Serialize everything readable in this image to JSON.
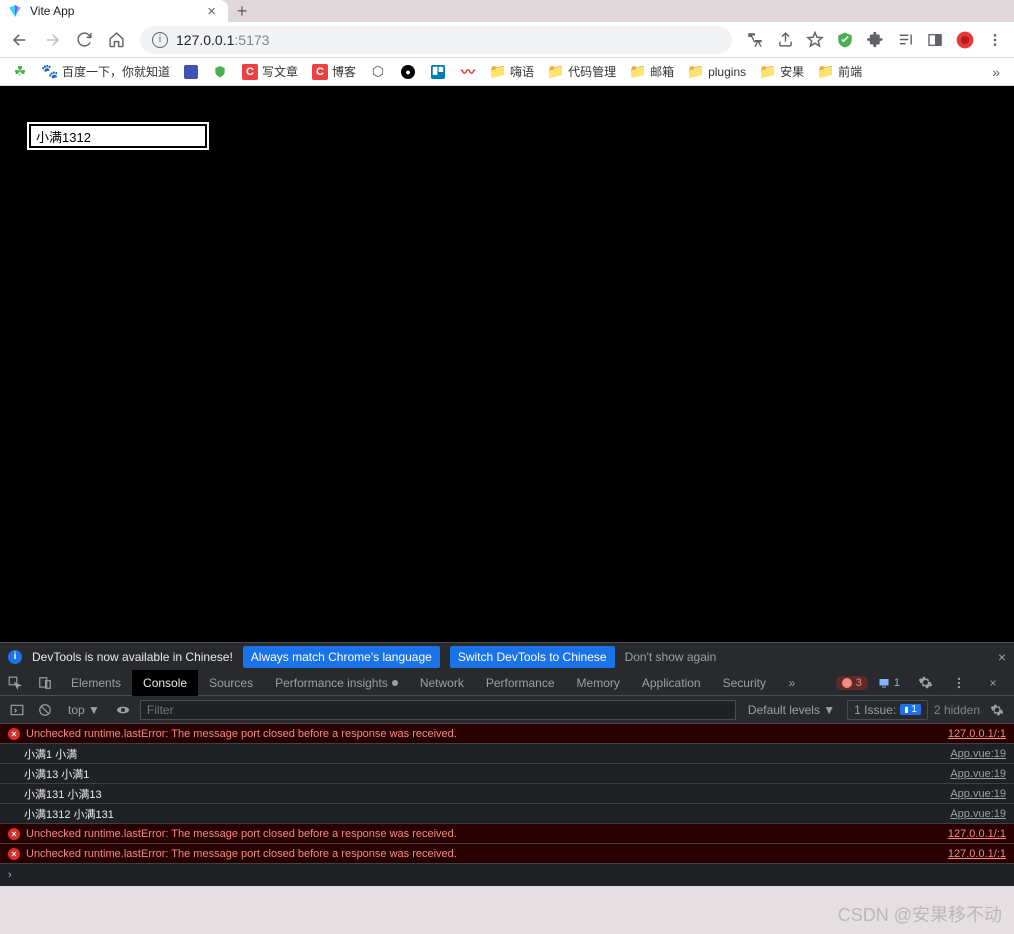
{
  "tab": {
    "title": "Vite App"
  },
  "address": {
    "host": "127.0.0.1",
    "port": ":5173"
  },
  "bookmarks": [
    {
      "label": "",
      "icon": "clover",
      "color": "#4caf50"
    },
    {
      "label": "百度一下，你就知道",
      "icon": "paw",
      "color": "#2932e1"
    },
    {
      "label": "",
      "icon": "shape",
      "color": "#3f51b5"
    },
    {
      "label": "",
      "icon": "shield",
      "color": "#4caf50"
    },
    {
      "label": "写文章",
      "icon": "C",
      "color": "#ec4141"
    },
    {
      "label": "博客",
      "icon": "C",
      "color": "#ec4141"
    },
    {
      "label": "",
      "icon": "hex",
      "color": "#555"
    },
    {
      "label": "",
      "icon": "dot",
      "color": "#000"
    },
    {
      "label": "",
      "icon": "trello",
      "color": "#0079bf"
    },
    {
      "label": "",
      "icon": "wave",
      "color": "#e53935"
    },
    {
      "label": "嗨语",
      "icon": "folder"
    },
    {
      "label": "代码管理",
      "icon": "folder"
    },
    {
      "label": "邮箱",
      "icon": "folder"
    },
    {
      "label": "plugins",
      "icon": "folder"
    },
    {
      "label": "安果",
      "icon": "folder"
    },
    {
      "label": "前端",
      "icon": "folder"
    }
  ],
  "page": {
    "input_value": "小满1312"
  },
  "banner": {
    "text": "DevTools is now available in Chinese!",
    "btn1": "Always match Chrome's language",
    "btn2": "Switch DevTools to Chinese",
    "dismiss": "Don't show again"
  },
  "devtools_tabs": [
    "Elements",
    "Console",
    "Sources",
    "Performance insights",
    "Network",
    "Performance",
    "Memory",
    "Application",
    "Security"
  ],
  "devtools_active": "Console",
  "error_count": "3",
  "issue_count": "1",
  "console": {
    "context": "top",
    "filter_placeholder": "Filter",
    "levels": "Default levels",
    "issue_label": "1 Issue:",
    "issue_badge": "1",
    "hidden": "2 hidden"
  },
  "messages": [
    {
      "type": "error",
      "text": "Unchecked runtime.lastError: The message port closed before a response was received.",
      "src": "127.0.0.1/:1"
    },
    {
      "type": "log",
      "text": "小满1 小满",
      "src": "App.vue:19"
    },
    {
      "type": "log",
      "text": "小满13 小满1",
      "src": "App.vue:19"
    },
    {
      "type": "log",
      "text": "小满131 小满13",
      "src": "App.vue:19"
    },
    {
      "type": "log",
      "text": "小满1312 小满131",
      "src": "App.vue:19"
    },
    {
      "type": "error",
      "text": "Unchecked runtime.lastError: The message port closed before a response was received.",
      "src": "127.0.0.1/:1"
    },
    {
      "type": "error",
      "text": "Unchecked runtime.lastError: The message port closed before a response was received.",
      "src": "127.0.0.1/:1"
    }
  ],
  "watermark": "CSDN @安果移不动"
}
